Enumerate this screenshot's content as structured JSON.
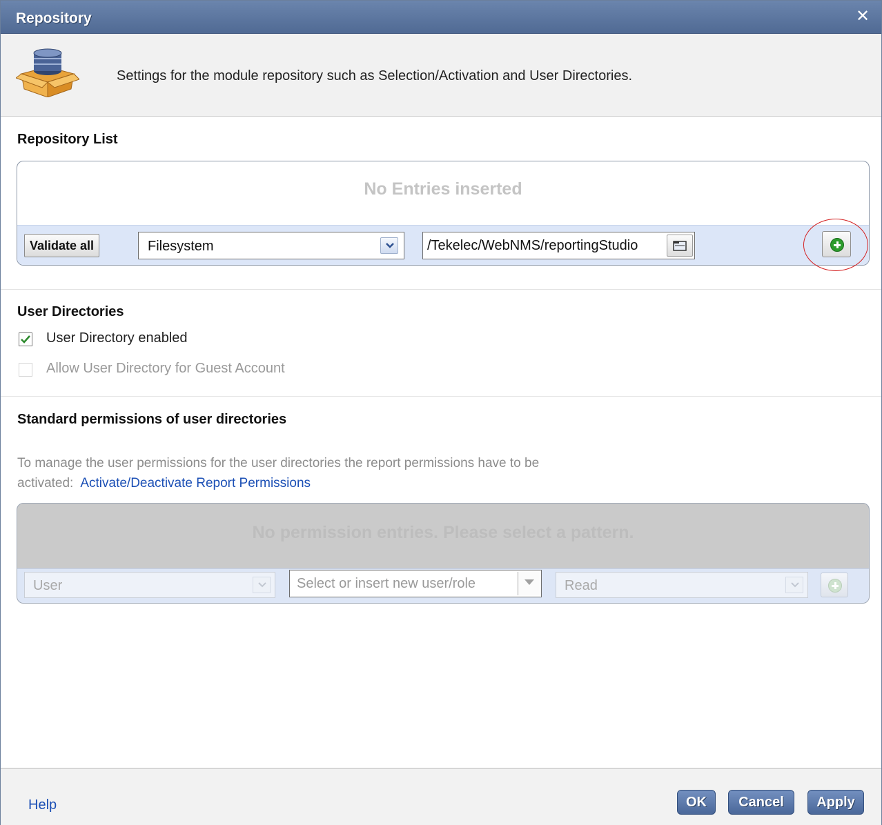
{
  "window": {
    "title": "Repository",
    "close_glyph": "✕"
  },
  "header": {
    "icon": "database-box-icon",
    "description": "Settings for the module repository such as Selection/Activation and User Directories."
  },
  "repository_list": {
    "title": "Repository List",
    "empty_text": "No Entries inserted",
    "validate_all_label": "Validate all",
    "type_select": {
      "value": "Filesystem"
    },
    "path_field": {
      "value": "/Tekelec/WebNMS/reportingStudio"
    },
    "browse_icon": "folder-browse-icon",
    "add_icon": "add-green-plus-icon",
    "highlight_color": "#d42020"
  },
  "user_directories": {
    "title": "User Directories",
    "enabled": {
      "label": "User Directory enabled",
      "checked": true
    },
    "guest": {
      "label": "Allow User Directory for Guest Account",
      "checked": false,
      "disabled": true
    }
  },
  "permissions": {
    "title": "Standard permissions of user directories",
    "info_line1": "To manage the user permissions for the user directories the report permissions have to be",
    "info_line2": "activated:",
    "link": "Activate/Deactivate Report Permissions",
    "empty_text": "No permission entries. Please select a pattern.",
    "type_select": {
      "value": "User"
    },
    "user_input": {
      "placeholder": "Select or insert new user/role"
    },
    "access_select": {
      "value": "Read"
    }
  },
  "footer": {
    "help": "Help",
    "ok": "OK",
    "cancel": "Cancel",
    "apply": "Apply"
  },
  "colors": {
    "title_bar": "#5a7399",
    "accent_blue": "#1b4fb5",
    "button_blue": "#4a6799",
    "add_green": "#2d9c2d"
  }
}
